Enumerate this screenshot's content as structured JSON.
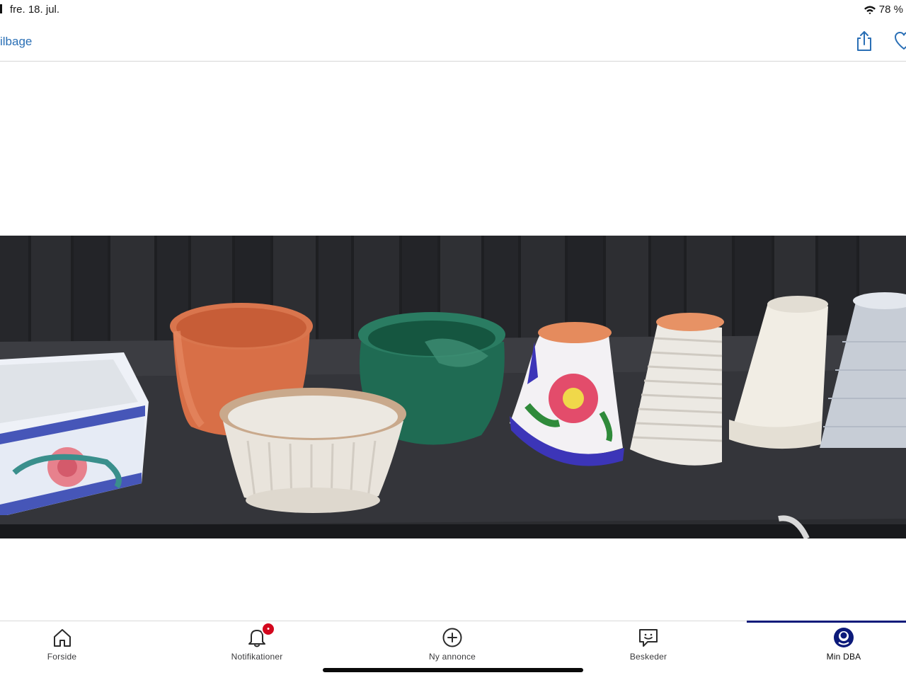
{
  "status_bar": {
    "date": "fre. 18. jul.",
    "battery": "78 %",
    "icons": [
      "wifi-icon"
    ]
  },
  "nav": {
    "back_label": "ilbage",
    "icons": [
      "share-icon",
      "heart-icon"
    ],
    "accent_color": "#2a6fb5"
  },
  "photo": {
    "subject": "listing-photo",
    "items": [
      "blue-white-ceramic-planter",
      "terracotta-pot",
      "white-ribbed-basket-pot",
      "green-glazed-pot",
      "painted-flower-pot",
      "white-ribbed-cone-pot",
      "white-pot",
      "grey-textured-pot"
    ]
  },
  "tab_bar": {
    "active_color": "#0c1a7a",
    "badge_color": "#d3071d",
    "badge_text": "•",
    "items": [
      {
        "label": "Forside",
        "icon": "home-icon"
      },
      {
        "label": "Notifikationer",
        "icon": "bell-icon"
      },
      {
        "label": "Ny annonce",
        "icon": "plus-circle-icon"
      },
      {
        "label": "Beskeder",
        "icon": "chat-icon"
      },
      {
        "label": "Min DBA",
        "icon": "profile-icon"
      }
    ],
    "active_index": 4
  }
}
